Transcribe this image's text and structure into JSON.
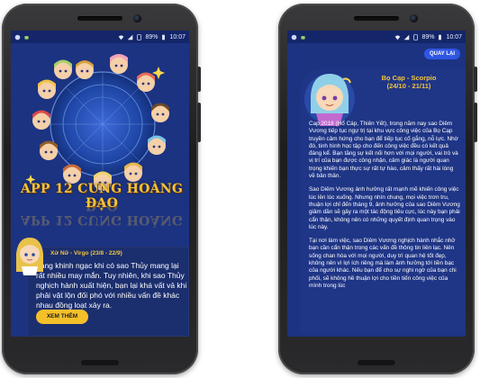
{
  "status_bar": {
    "battery": "89%",
    "time": "10:07"
  },
  "home": {
    "title": "APP 12 CUNG HOÀNG ĐẠO",
    "card_title": "Xử Nữ - Virgo (23/8 - 22/9)",
    "card_lines": [
      "đang khinh ngạc khi có sao Thủy mang lại",
      "rất nhiều may mắn. Tuy nhiên, khi sao Thủy",
      "nghịch hành xuất hiện, bạn lại khá vất vả khi",
      "phải vật lộn đối phó với nhiều vấn đề khác",
      "nhau đồng loạt xảy ra."
    ],
    "more_button": "XEM THÊM"
  },
  "detail": {
    "back_button": "QUAY LẠI",
    "sign_name": "Bọ Cạp - Scorpio",
    "sign_dates": "(24/10 - 21/11)",
    "paragraphs": [
      "Cap 2018 (Hổ Cáp, Thiên Yết), trong năm nay sao Diêm Vương tiếp tục ngự trị tại khu vực công việc của Bọ Cạp truyền cảm hứng cho bạn để tiếp tục cố gắng, nỗ lực. Nhờ đó, tinh hình học tập cho đến công việc đều có kết quả đáng kể. Bạn tăng sự kết nối hơn với mọi người, vai trò và vị trí của bạn được công nhận, cảm giác là người quan trọng khiến bạn thực sự rất tự hào, cảm thấy rất hài lòng về bản thân.",
      "Sao Diêm Vương ảnh hưởng rất mạnh mẽ khiến công việc lúc lên lúc xuống. Nhưng nhìn chung, mọi việc trơn tru, thuận lợi chỉ đến tháng 9, ảnh hưởng của sao Diêm Vương giảm dần sẽ gây ra một tác động tiêu cực, lúc này bạn phải cẩn thận, không nên có những quyết định quan trọng vào lúc này.",
      "Tại nơi làm việc, sao Diêm Vương nghịch hành nhắc nhở bạn cần cẩn thận trong các vấn đề thông tin liên lạc. Nên sống chan hòa với mọi người, duy trì quan hệ tốt đẹp, không nên vì lợi ích riêng mà làm ảnh hưởng tới tiền bạc của người khác. Nếu bạn để cho sự nghi ngờ của bạn chi phối, sẽ không hề thuận lợi cho tiền tiến công việc của mình trong lúc"
    ]
  },
  "colors": {
    "screen_bg": "#1c3382",
    "card_bg": "#1b2e6e",
    "accent_gold": "#f4c02a",
    "back_button": "#2f56e3"
  }
}
